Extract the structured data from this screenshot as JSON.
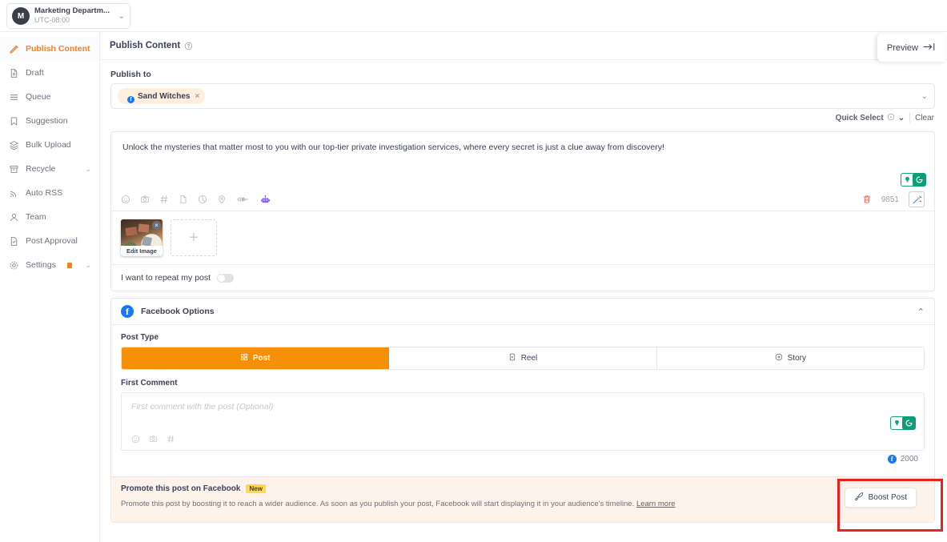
{
  "workspace": {
    "avatar_initial": "M",
    "name": "Marketing Departm...",
    "timezone": "UTC-08:00",
    "caret": "⌄"
  },
  "sidebar": {
    "items": [
      {
        "label": "Publish Content",
        "icon": "pencil-icon",
        "active": true
      },
      {
        "label": "Draft",
        "icon": "document-icon",
        "active": false
      },
      {
        "label": "Queue",
        "icon": "list-icon",
        "active": false
      },
      {
        "label": "Suggestion",
        "icon": "bookmark-icon",
        "active": false
      },
      {
        "label": "Bulk Upload",
        "icon": "layers-icon",
        "active": false
      },
      {
        "label": "Recycle",
        "icon": "recycle-bin-icon",
        "active": false,
        "caret": "⌄"
      },
      {
        "label": "Auto RSS",
        "icon": "rss-icon",
        "active": false
      },
      {
        "label": "Team",
        "icon": "user-icon",
        "active": false
      },
      {
        "label": "Post Approval",
        "icon": "approval-icon",
        "active": false
      },
      {
        "label": "Settings",
        "icon": "gear-icon",
        "active": false,
        "caret": "⌄",
        "dot": true
      }
    ]
  },
  "header": {
    "title": "Publish Content",
    "help_icon": "question-mark-icon",
    "preview_label": "Preview",
    "preview_icon": "arrow-to-line-icon"
  },
  "publish_to": {
    "label": "Publish to",
    "account": {
      "name": "Sand Witches",
      "network": "facebook",
      "remove": "×"
    },
    "caret": "⌄",
    "quick_select_label": "Quick Select",
    "quick_select_icon": "info-circle-icon",
    "quick_select_caret": "⌄",
    "clear_label": "Clear"
  },
  "composer": {
    "content": "Unlock the mysteries that matter most to you with our top-tier private investigation services, where every secret is just a clue away from discovery!",
    "toolbar_icons": [
      "emoji-icon",
      "camera-icon",
      "hashtag-icon",
      "document-icon",
      "pie-chart-icon",
      "location-pin-icon",
      "link-plug-icon",
      "ai-robot-icon"
    ],
    "ai_badge_left": "lightbulb-icon",
    "ai_badge_right": "grammarly-icon",
    "delete_icon": "trash-icon",
    "char_count": "9851",
    "magic_icon": "magic-wand-icon",
    "media": {
      "thumb_caption": "Edit Image",
      "thumb_remove": "×",
      "add_icon": "plus-icon"
    },
    "repeat_label": "I want to repeat my post",
    "repeat_on": false
  },
  "facebook_options": {
    "title": "Facebook Options",
    "logo": "facebook-icon",
    "collapse_caret": "⌃",
    "post_type_label": "Post Type",
    "post_types": [
      {
        "label": "Post",
        "icon": "grid-icon",
        "active": true
      },
      {
        "label": "Reel",
        "icon": "reel-icon",
        "active": false
      },
      {
        "label": "Story",
        "icon": "story-plus-icon",
        "active": false
      }
    ],
    "first_comment_label": "First Comment",
    "first_comment_placeholder": "First comment with the post (Optional)",
    "first_comment_value": "",
    "first_comment_icons": [
      "emoji-icon",
      "camera-icon",
      "hashtag-icon"
    ],
    "first_comment_ai_left": "lightbulb-icon",
    "first_comment_ai_right": "grammarly-icon",
    "char_limit": "2000"
  },
  "promote": {
    "title": "Promote this post on Facebook",
    "badge": "New",
    "description": "Promote this post by boosting it to reach a wider audience. As soon as you publish your post, Facebook will start displaying it in your audience's timeline.",
    "learn_more": "Learn more",
    "boost_label": "Boost Post",
    "boost_icon": "rocket-icon",
    "highlight_color": "#e8231e"
  }
}
